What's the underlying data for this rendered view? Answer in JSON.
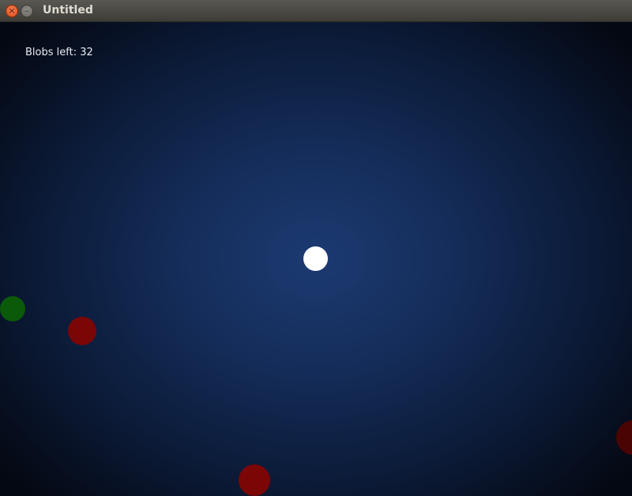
{
  "window": {
    "title": "Untitled",
    "close_glyph": "×",
    "minimize_glyph": "–"
  },
  "hud": {
    "blobs_left_text": "Blobs left: 32"
  },
  "colors": {
    "player": "#ffffff",
    "food_green": "#0a5a0a",
    "enemy_red": "#7a0606",
    "enemy_dark_red": "#4a0404"
  },
  "icons": {
    "close": "close-icon",
    "minimize": "minimize-icon"
  }
}
